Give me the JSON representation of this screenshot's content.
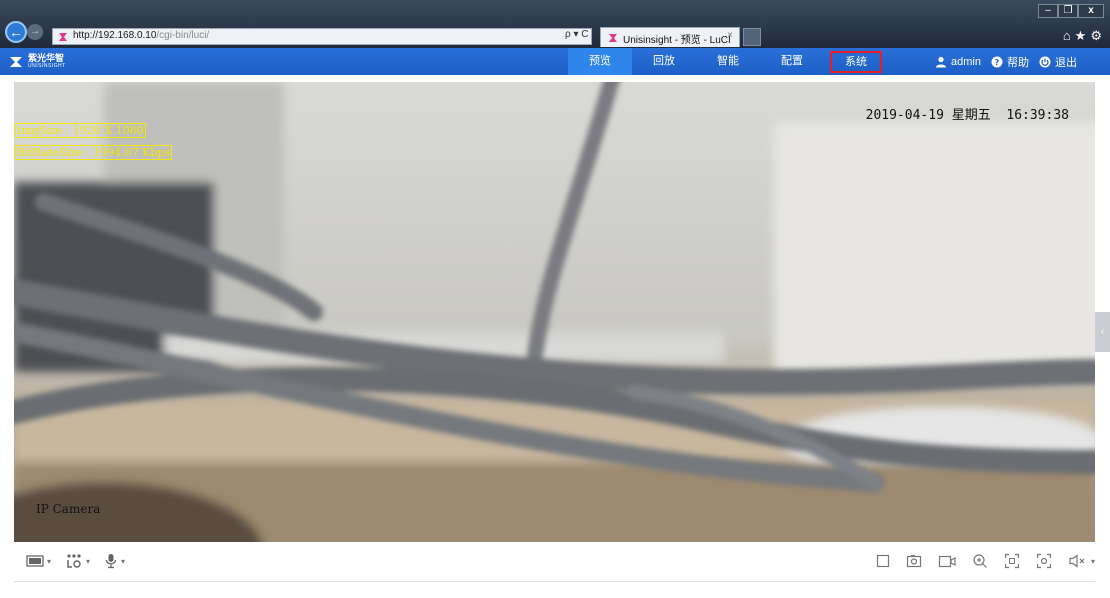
{
  "browser": {
    "url_host": "http://192.168.0.10",
    "url_path": "/cgi-bin/luci/",
    "address_tools": "ρ ▾ C",
    "tab_title": "Unisinsight - 预览 - LuCI",
    "tab_close": "×",
    "window_min": "–",
    "window_max": "❐",
    "window_close": "x",
    "right_icons": "⌂★⚙"
  },
  "header": {
    "logo_cn": "紫光华智",
    "logo_en": "UNISINSIGHT",
    "nav": [
      {
        "label": "预览",
        "active": true
      },
      {
        "label": "回放",
        "active": false
      },
      {
        "label": "智能",
        "active": false
      },
      {
        "label": "配置",
        "active": false
      },
      {
        "label": "系统",
        "active": false,
        "highlighted": true
      }
    ],
    "user": "admin",
    "help": "帮助",
    "logout": "退出"
  },
  "osd": {
    "img_size": "ImgSize : 1920 X 1080",
    "bitrate": "BitRateSize : 1994.07 Kbps",
    "datetime": "2019-04-19 星期五  16:39:38",
    "camera_name": "IP Camera"
  },
  "side_toggle": "‹",
  "toolbar": {
    "left": [
      {
        "icon": "stream-icon",
        "caret": "▾"
      },
      {
        "icon": "ptz-icon",
        "caret": "▾"
      },
      {
        "icon": "microphone-icon",
        "caret": "▾"
      }
    ],
    "right": [
      {
        "icon": "window-icon"
      },
      {
        "icon": "snapshot-icon"
      },
      {
        "icon": "record-icon"
      },
      {
        "icon": "zoom-in-icon"
      },
      {
        "icon": "fullscreen-icon"
      },
      {
        "icon": "focus-icon"
      },
      {
        "icon": "mute-icon",
        "caret": "▾"
      }
    ]
  },
  "colors": {
    "header_blue": "#1d5fc6",
    "active_nav": "#2f86ea",
    "highlight_red": "#e42026",
    "osd_yellow": "#f4e600"
  }
}
